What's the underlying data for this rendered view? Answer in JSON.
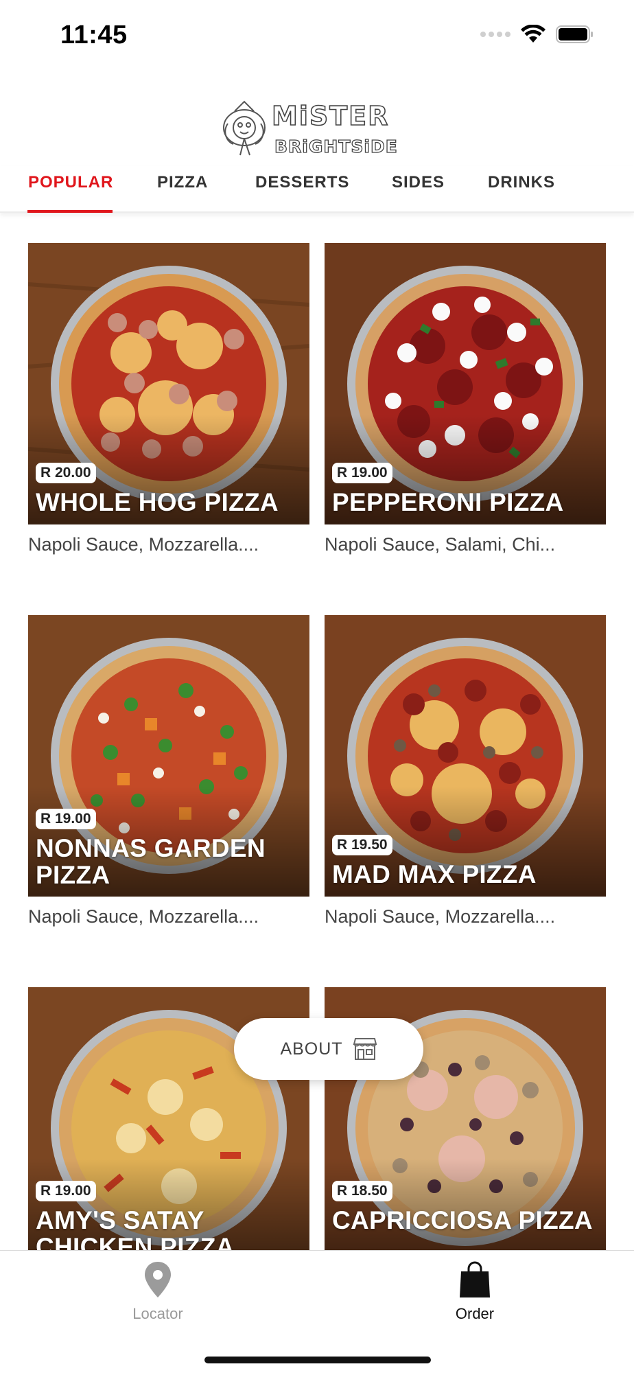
{
  "status_bar": {
    "time": "11:45"
  },
  "brand": {
    "name": "Mister Brightside",
    "accent_color": "#e0161c"
  },
  "tabs": [
    {
      "label": "POPULAR"
    },
    {
      "label": "PIZZA"
    },
    {
      "label": "DESSERTS"
    },
    {
      "label": "SIDES"
    },
    {
      "label": "DRINKS"
    }
  ],
  "active_tab": "POPULAR",
  "products": [
    {
      "price": "R 20.00",
      "name": "WHOLE HOG PIZZA",
      "desc": "Napoli Sauce, Mozzarella...."
    },
    {
      "price": "R 19.00",
      "name": "PEPPERONI PIZZA",
      "desc": "Napoli Sauce, Salami, Chi..."
    },
    {
      "price": "R 19.00",
      "name": "NONNAS GARDEN PIZZA",
      "desc": "Napoli Sauce, Mozzarella...."
    },
    {
      "price": "R 19.50",
      "name": "MAD MAX PIZZA",
      "desc": "Napoli Sauce, Mozzarella...."
    },
    {
      "price": "R 19.00",
      "name": "AMY'S SATAY CHICKEN PIZZA",
      "desc": ""
    },
    {
      "price": "R 18.50",
      "name": "CAPRICCIOSA PIZZA",
      "desc": ""
    }
  ],
  "about_button": {
    "label": "ABOUT",
    "icon": "store-icon"
  },
  "bottom_nav": [
    {
      "label": "Locator",
      "icon": "location-pin-icon",
      "active": false
    },
    {
      "label": "Order",
      "icon": "shopping-bag-icon",
      "active": true
    }
  ]
}
